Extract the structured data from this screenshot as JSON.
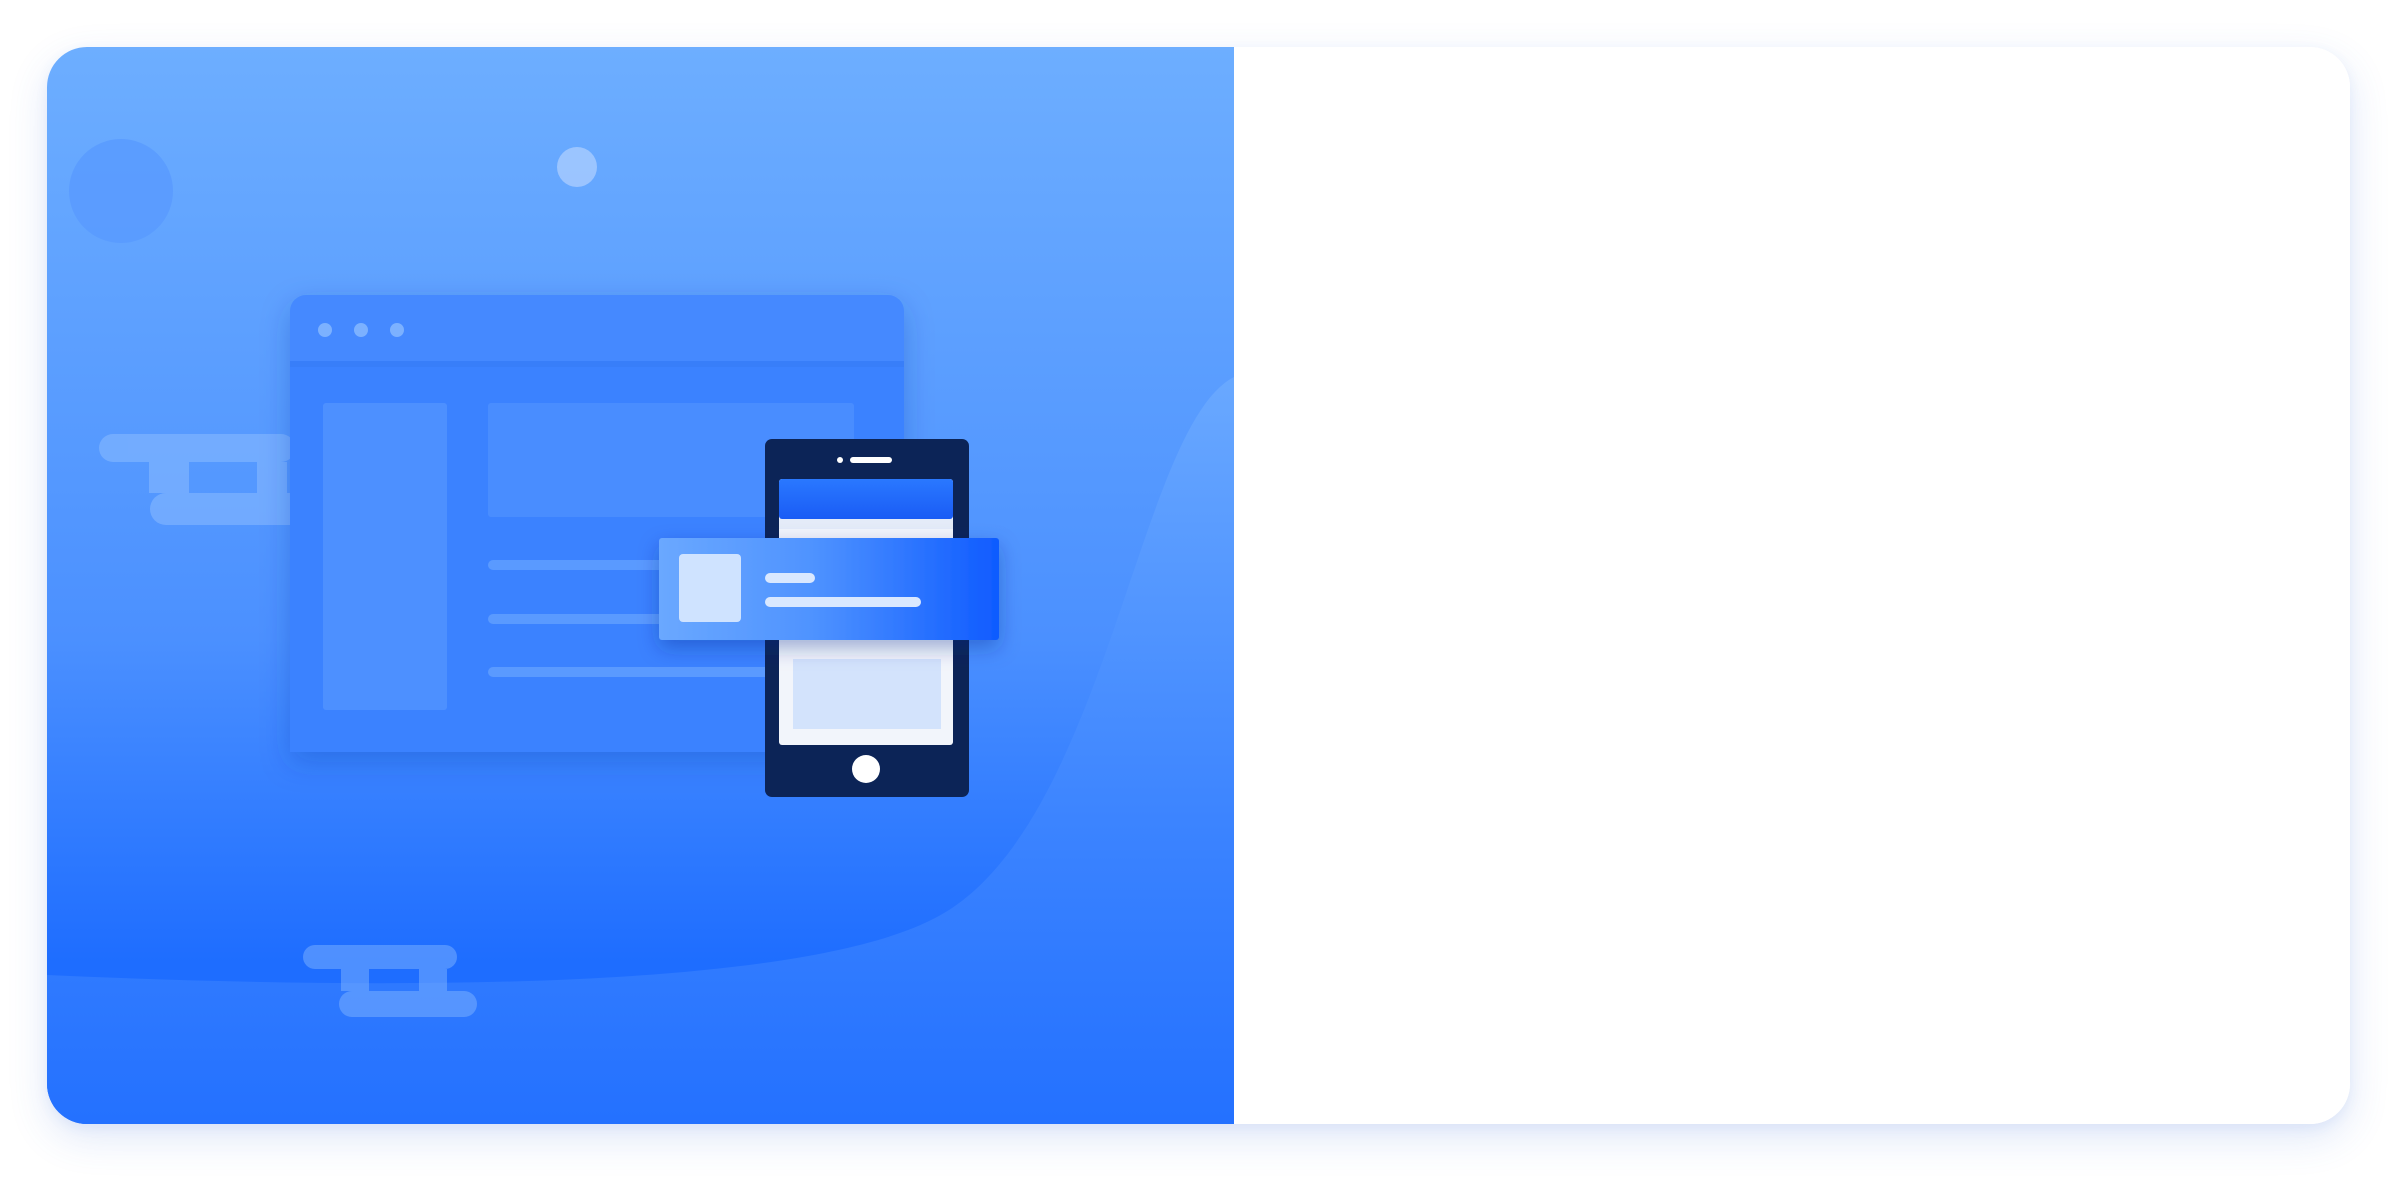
{
  "colors": {
    "page_background": "#ffffff",
    "illustration_top": "#6daeff",
    "illustration_bottom": "#1e6dff",
    "phone_body": "#0c2457",
    "brand_blue": "#1a63ff",
    "content_panel_background": "#ffffff"
  },
  "illustration": {
    "icons": [
      "browser-window-icon",
      "smartphone-icon",
      "notification-card-icon",
      "cloud-icon",
      "bubble-icon"
    ]
  },
  "content_panel": {}
}
